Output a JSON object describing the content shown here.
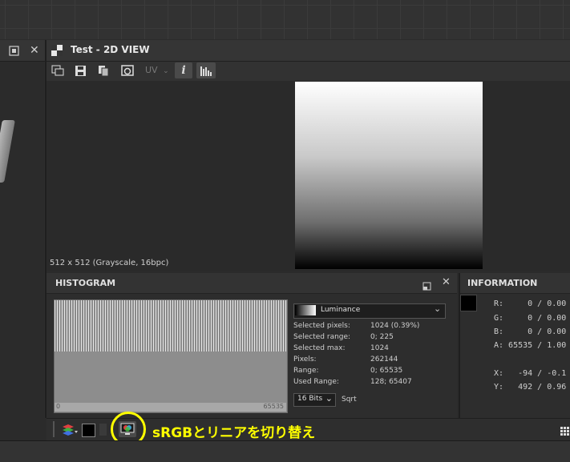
{
  "left_panel": {
    "maximize_icon": "maximize-icon",
    "close_icon": "close-icon"
  },
  "view": {
    "title": "Test - 2D VIEW",
    "toolbar": {
      "uv_label": "UV",
      "info_label": "i"
    },
    "image_info": "512 x 512 (Grayscale, 16bpc)"
  },
  "histogram": {
    "title": "HISTOGRAM",
    "channel": "Luminance",
    "axis_min": "0",
    "axis_max": "65535",
    "stats": [
      {
        "label": "Selected pixels:",
        "value": "1024 (0.39%)"
      },
      {
        "label": "Selected range:",
        "value": "0; 225"
      },
      {
        "label": "Selected max:",
        "value": "1024"
      },
      {
        "label": "Pixels:",
        "value": "262144"
      },
      {
        "label": "Range:",
        "value": "0; 65535"
      },
      {
        "label": "Used Range:",
        "value": "128; 65407"
      }
    ],
    "bits": "16 Bits",
    "scale": "Sqrt"
  },
  "information": {
    "title": "INFORMATION",
    "r": "R:     0 / 0.00",
    "g": "G:     0 / 0.00",
    "b": "B:     0 / 0.00",
    "a": "A: 65535 / 1.00",
    "x": "X:   -94 / -0.1",
    "y": "Y:   492 / 0.96"
  },
  "annotation": "sRGBとリニアを切り替え",
  "colors": {
    "highlight": "#ffff00",
    "background": "#2b2b2b"
  }
}
